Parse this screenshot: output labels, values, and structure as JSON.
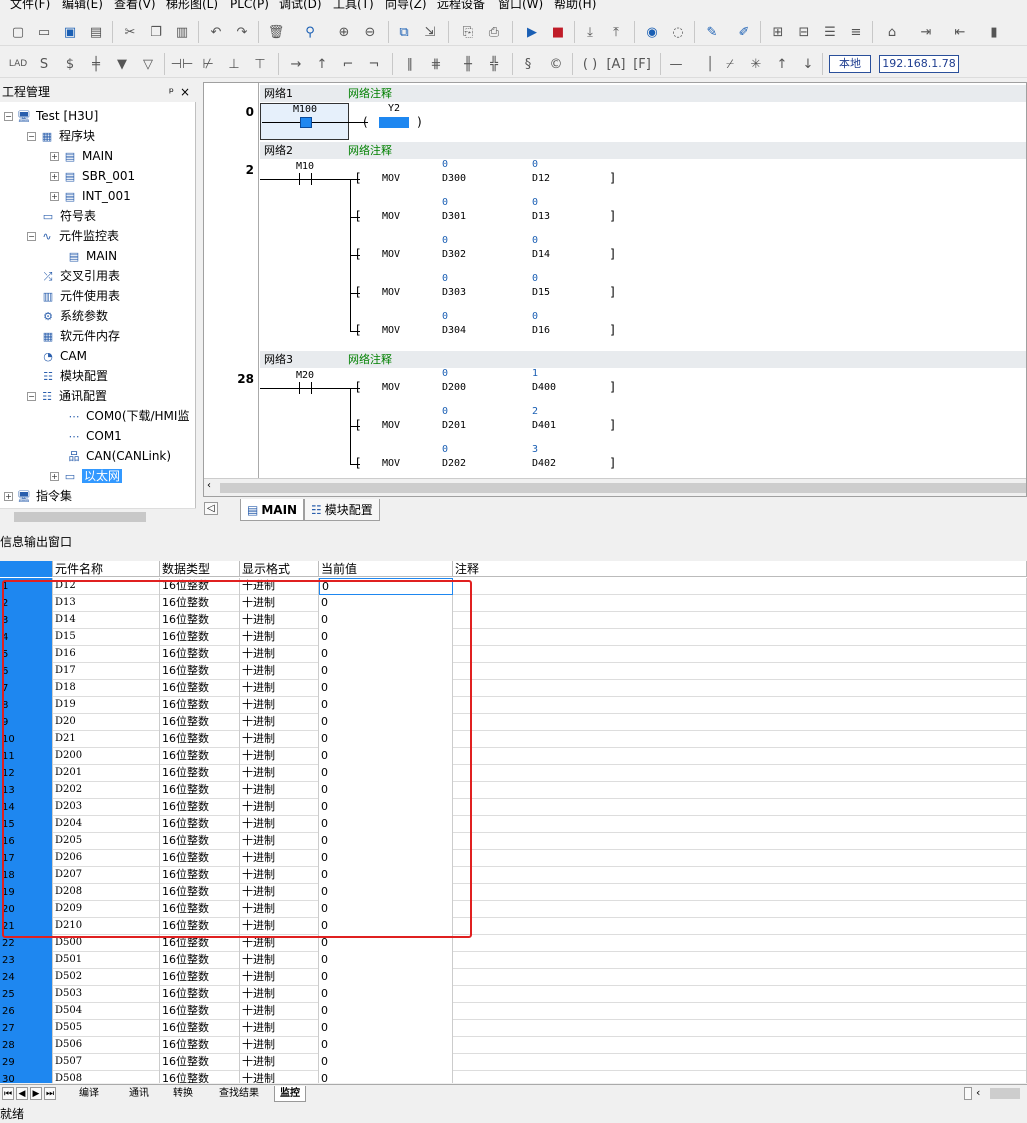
{
  "menu": [
    "文件(F)",
    "编辑(E)",
    "查看(V)",
    "梯形图(L)",
    "PLC(P)",
    "调试(D)",
    "工具(T)",
    "向导(Z)",
    "远程设备",
    "窗口(W)",
    "帮助(H)"
  ],
  "connection": {
    "local": "本地",
    "ip": "192.168.1.78"
  },
  "project_pane": {
    "title": "工程管理",
    "pin": "ᵖ",
    "close": "×",
    "root": "Test [H3U]",
    "program_block": "程序块",
    "programs": [
      "MAIN",
      "SBR_001",
      "INT_001"
    ],
    "symbol_table": "符号表",
    "monitor_table": "元件监控表",
    "monitor_main": "MAIN",
    "cross_ref": "交叉引用表",
    "usage": "元件使用表",
    "sys_params": "系统参数",
    "soft_mem": "软元件内存",
    "cam": "CAM",
    "module_cfg": "模块配置",
    "comm_cfg": "通讯配置",
    "comm_items": [
      "COM0(下载/HMI监",
      "COM1",
      "CAN(CANLink)",
      "以太网"
    ],
    "instr_set": "指令集"
  },
  "ladder": {
    "networks": [
      {
        "label": "网络1",
        "comment": "网络注释",
        "step": "0"
      },
      {
        "label": "网络2",
        "comment": "网络注释",
        "step": "2"
      },
      {
        "label": "网络3",
        "comment": "网络注释",
        "step": "28"
      }
    ],
    "n1": {
      "contact": "M100",
      "coil": "Y2"
    },
    "n2": {
      "contact": "M10",
      "rows": [
        {
          "op": "MOV",
          "src": "D300",
          "sv": "0",
          "dst": "D12",
          "dv": "0"
        },
        {
          "op": "MOV",
          "src": "D301",
          "sv": "0",
          "dst": "D13",
          "dv": "0"
        },
        {
          "op": "MOV",
          "src": "D302",
          "sv": "0",
          "dst": "D14",
          "dv": "0"
        },
        {
          "op": "MOV",
          "src": "D303",
          "sv": "0",
          "dst": "D15",
          "dv": "0"
        },
        {
          "op": "MOV",
          "src": "D304",
          "sv": "0",
          "dst": "D16",
          "dv": "0"
        }
      ]
    },
    "n3": {
      "contact": "M20",
      "rows": [
        {
          "op": "MOV",
          "src": "D200",
          "sv": "0",
          "dst": "D400",
          "dv": "1"
        },
        {
          "op": "MOV",
          "src": "D201",
          "sv": "0",
          "dst": "D401",
          "dv": "2"
        },
        {
          "op": "MOV",
          "src": "D202",
          "sv": "0",
          "dst": "D402",
          "dv": "3"
        }
      ]
    }
  },
  "doc_tabs": [
    "MAIN",
    "模块配置"
  ],
  "info_title": "信息输出窗口",
  "monitor": {
    "headers": [
      "",
      "元件名称",
      "数据类型",
      "显示格式",
      "当前值",
      "注释"
    ],
    "rows": [
      [
        "1",
        "D12",
        "16位整数",
        "十进制",
        "0"
      ],
      [
        "2",
        "D13",
        "16位整数",
        "十进制",
        "0"
      ],
      [
        "3",
        "D14",
        "16位整数",
        "十进制",
        "0"
      ],
      [
        "4",
        "D15",
        "16位整数",
        "十进制",
        "0"
      ],
      [
        "5",
        "D16",
        "16位整数",
        "十进制",
        "0"
      ],
      [
        "6",
        "D17",
        "16位整数",
        "十进制",
        "0"
      ],
      [
        "7",
        "D18",
        "16位整数",
        "十进制",
        "0"
      ],
      [
        "8",
        "D19",
        "16位整数",
        "十进制",
        "0"
      ],
      [
        "9",
        "D20",
        "16位整数",
        "十进制",
        "0"
      ],
      [
        "10",
        "D21",
        "16位整数",
        "十进制",
        "0"
      ],
      [
        "11",
        "D200",
        "16位整数",
        "十进制",
        "0"
      ],
      [
        "12",
        "D201",
        "16位整数",
        "十进制",
        "0"
      ],
      [
        "13",
        "D202",
        "16位整数",
        "十进制",
        "0"
      ],
      [
        "14",
        "D203",
        "16位整数",
        "十进制",
        "0"
      ],
      [
        "15",
        "D204",
        "16位整数",
        "十进制",
        "0"
      ],
      [
        "16",
        "D205",
        "16位整数",
        "十进制",
        "0"
      ],
      [
        "17",
        "D206",
        "16位整数",
        "十进制",
        "0"
      ],
      [
        "18",
        "D207",
        "16位整数",
        "十进制",
        "0"
      ],
      [
        "19",
        "D208",
        "16位整数",
        "十进制",
        "0"
      ],
      [
        "20",
        "D209",
        "16位整数",
        "十进制",
        "0"
      ],
      [
        "21",
        "D210",
        "16位整数",
        "十进制",
        "0"
      ],
      [
        "22",
        "D500",
        "16位整数",
        "十进制",
        "0"
      ],
      [
        "23",
        "D501",
        "16位整数",
        "十进制",
        "0"
      ],
      [
        "24",
        "D502",
        "16位整数",
        "十进制",
        "0"
      ],
      [
        "25",
        "D503",
        "16位整数",
        "十进制",
        "0"
      ],
      [
        "26",
        "D504",
        "16位整数",
        "十进制",
        "0"
      ],
      [
        "27",
        "D505",
        "16位整数",
        "十进制",
        "0"
      ],
      [
        "28",
        "D506",
        "16位整数",
        "十进制",
        "0"
      ],
      [
        "29",
        "D507",
        "16位整数",
        "十进制",
        "0"
      ],
      [
        "30",
        "D508",
        "16位整数",
        "十进制",
        "0"
      ]
    ]
  },
  "bottom_tabs": [
    "编译",
    "通讯",
    "转换",
    "查找结果",
    "监控"
  ],
  "status": "就绪",
  "colors": {
    "accent": "#1e87f0",
    "highlight_box": "#e02020",
    "comment": "#008000"
  }
}
